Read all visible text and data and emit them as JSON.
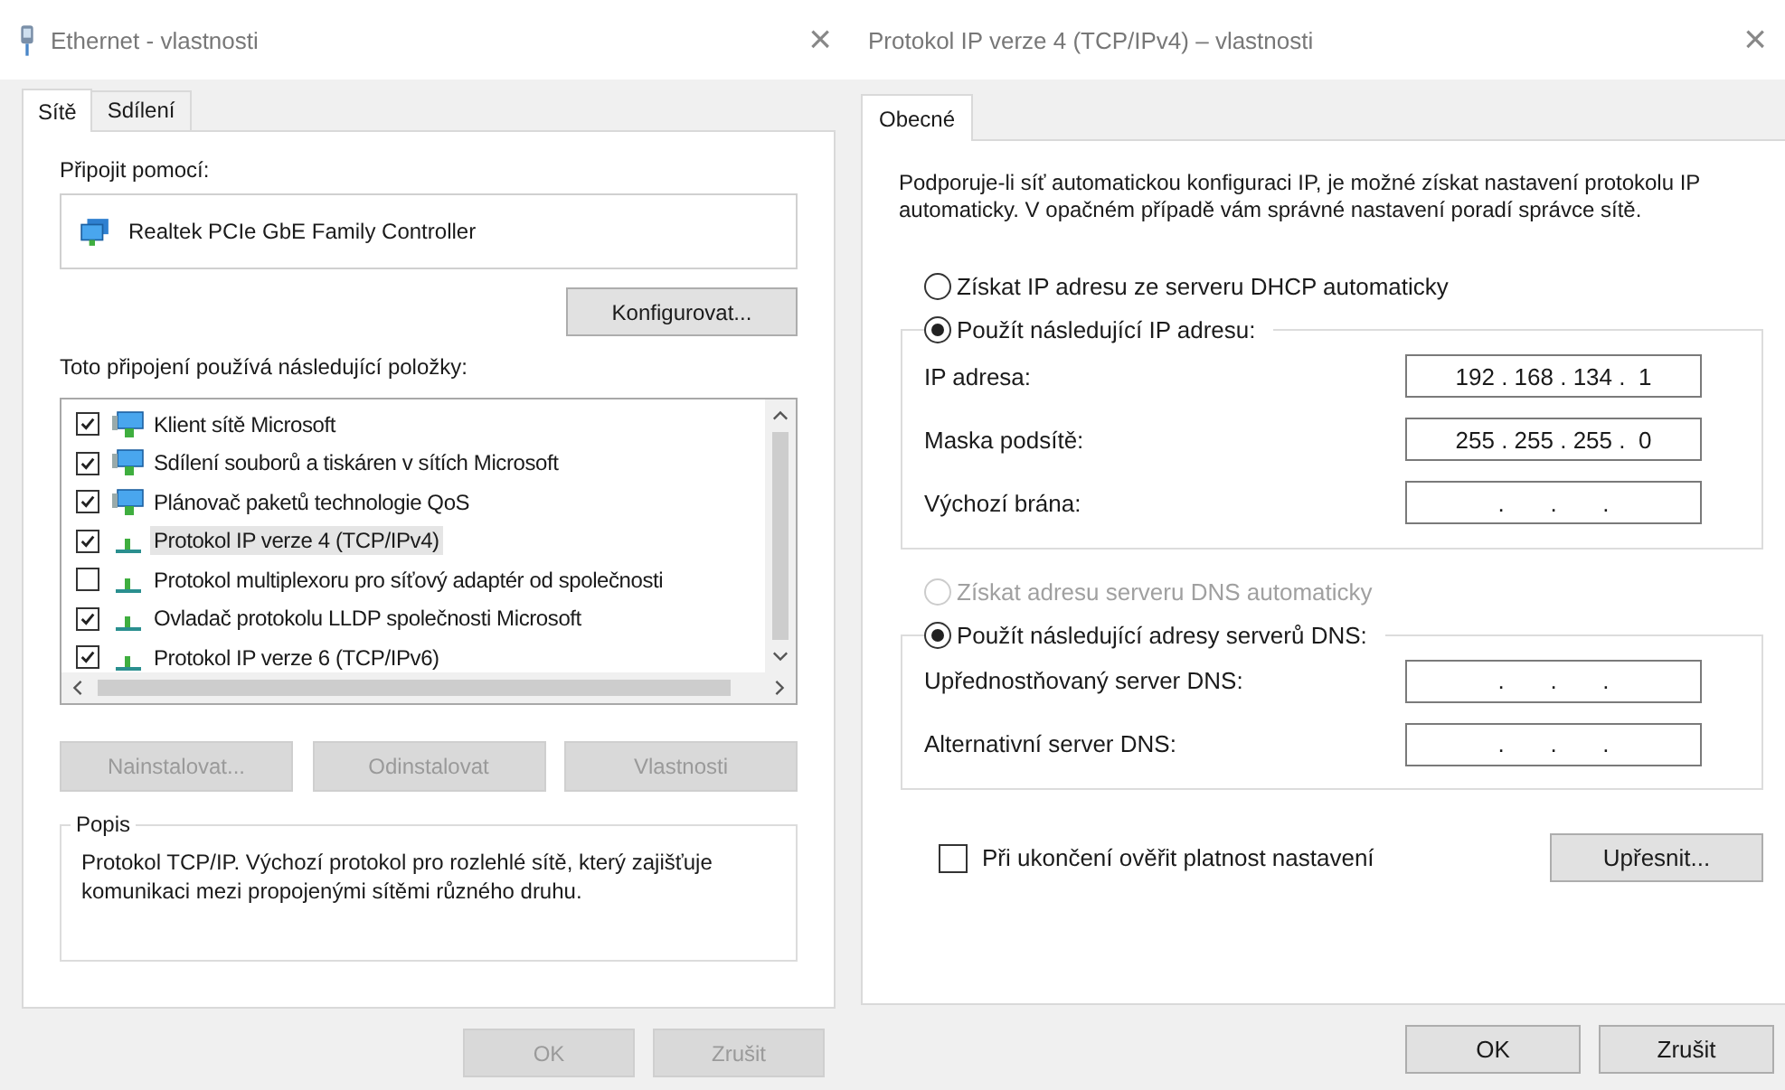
{
  "left_dialog": {
    "title": "Ethernet - vlastnosti",
    "close": "×",
    "tabs": [
      {
        "label": "Sítě",
        "selected": true
      },
      {
        "label": "Sdílení",
        "selected": false
      }
    ],
    "connect_label": "Připojit pomocí:",
    "adapter": "Realtek PCIe GbE Family Controller",
    "configure_button": "Konfigurovat...",
    "items_label": "Toto připojení používá následující položky:",
    "items": [
      {
        "label": "Klient sítě Microsoft",
        "kind": "service",
        "checked": true,
        "selected": false
      },
      {
        "label": "Sdílení souborů a tiskáren v sítích Microsoft",
        "kind": "service",
        "checked": true,
        "selected": false
      },
      {
        "label": "Plánovač paketů technologie QoS",
        "kind": "service",
        "checked": true,
        "selected": false
      },
      {
        "label": "Protokol IP verze 4 (TCP/IPv4)",
        "kind": "protocol",
        "checked": true,
        "selected": true
      },
      {
        "label": "Protokol multiplexoru pro síťový adaptér od společnosti",
        "kind": "protocol",
        "checked": false,
        "selected": false
      },
      {
        "label": "Ovladač protokolu LLDP společnosti Microsoft",
        "kind": "protocol",
        "checked": true,
        "selected": false
      },
      {
        "label": "Protokol IP verze 6 (TCP/IPv6)",
        "kind": "protocol",
        "checked": true,
        "selected": false
      }
    ],
    "item_buttons": [
      {
        "label": "Nainstalovat...",
        "disabled": true
      },
      {
        "label": "Odinstalovat",
        "disabled": true
      },
      {
        "label": "Vlastnosti",
        "disabled": true
      }
    ],
    "description_title": "Popis",
    "description": "Protokol TCP/IP. Výchozí protokol pro rozlehlé sítě, který zajišťuje komunikaci mezi propojenými sítěmi různého druhu.",
    "buttons": [
      {
        "label": "OK",
        "disabled": true
      },
      {
        "label": "Zrušit",
        "disabled": true
      }
    ]
  },
  "right_dialog": {
    "title": "Protokol IP verze 4 (TCP/IPv4) – vlastnosti",
    "close": "×",
    "tabs": [
      {
        "label": "Obecné",
        "selected": true
      }
    ],
    "intro": "Podporuje-li síť automatickou konfiguraci IP, je možné získat nastavení protokolu IP automaticky. V opačném případě vám správné nastavení poradí správce sítě.",
    "ip_auto": {
      "label": "Získat IP adresu ze serveru DHCP automaticky",
      "selected": false,
      "disabled": false
    },
    "ip_manual": {
      "label": "Použít následující IP adresu:",
      "selected": true,
      "disabled": false
    },
    "ip_fields": [
      {
        "label": "IP adresa:",
        "value": "192 . 168 . 134 .  1"
      },
      {
        "label": "Maska podsítě:",
        "value": "255 . 255 . 255 .  0"
      },
      {
        "label": "Výchozí brána:",
        "value": ".       .       ."
      }
    ],
    "dns_auto": {
      "label": "Získat adresu serveru DNS automaticky",
      "selected": false,
      "disabled": true
    },
    "dns_manual": {
      "label": "Použít následující adresy serverů DNS:",
      "selected": true,
      "disabled": false
    },
    "dns_fields": [
      {
        "label": "Upřednostňovaný server DNS:",
        "value": ".       .       ."
      },
      {
        "label": "Alternativní server DNS:",
        "value": ".       .       ."
      }
    ],
    "validate": {
      "label": "Při ukončení ověřit platnost nastavení",
      "checked": false
    },
    "advanced_button": "Upřesnit...",
    "buttons": [
      {
        "label": "OK",
        "disabled": false
      },
      {
        "label": "Zrušit",
        "disabled": false
      }
    ]
  }
}
